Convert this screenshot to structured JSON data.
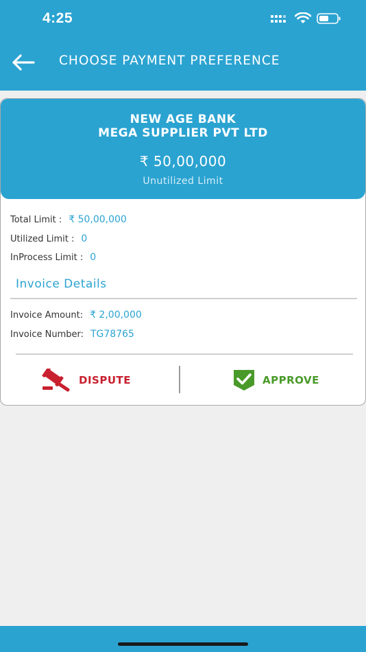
{
  "status": {
    "time": "4:25",
    "signal_icon": "signal-icon",
    "wifi_icon": "wifi-icon",
    "battery_icon": "battery-icon"
  },
  "appbar": {
    "title": "CHOOSE PAYMENT PREFERENCE",
    "back_icon": "arrow-left-icon"
  },
  "card": {
    "bank": "NEW AGE BANK",
    "supplier": "MEGA SUPPLIER PVT LTD",
    "limit_amount": "₹ 50,00,000",
    "limit_caption": "Unutilized Limit",
    "total_limit_label": "Total Limit :",
    "total_limit_value": "₹ 50,00,000",
    "utilized_limit_label": "Utilized Limit :",
    "utilized_limit_value": "0",
    "inprocess_limit_label": "InProcess Limit :",
    "inprocess_limit_value": "0",
    "invoice_section_title": "Invoice Details",
    "invoice_amount_label": "Invoice Amount:",
    "invoice_amount_value": "₹ 2,00,000",
    "invoice_number_label": "Invoice Number:",
    "invoice_number_value": "TG78765"
  },
  "actions": {
    "dispute_label": "DISPUTE",
    "dispute_icon": "gavel-icon",
    "approve_label": "APPROVE",
    "approve_icon": "check-shield-icon"
  },
  "colors": {
    "primary": "#2ba3d1",
    "dispute": "#c8202f",
    "approve": "#4a9a2a",
    "background": "#efefef"
  }
}
